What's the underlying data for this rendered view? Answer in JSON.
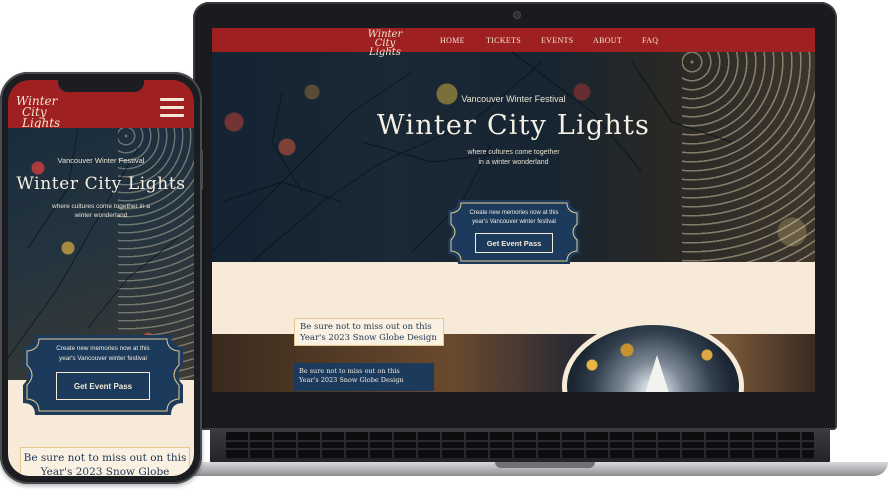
{
  "site": {
    "logo": {
      "line1": "Winter",
      "line2": "City Lights"
    },
    "nav": [
      "HOME",
      "TICKETS",
      "EVENTS",
      "ABOUT",
      "FAQ"
    ],
    "hero": {
      "eyebrow": "Vancouver Winter Festival",
      "title": "Winter City Lights",
      "tagline_line1": "where cultures come together",
      "tagline_line2": "in a winter wonderland",
      "mobile_tagline_line1": "where cultures come together in a",
      "mobile_tagline_line2": "winter wonderland"
    },
    "ticket": {
      "text_line1": "Create new memories now at this",
      "text_line2": "year's Vancouver winter festival",
      "button": "Get Event Pass"
    },
    "promo": {
      "line1": "Be sure not to miss out on this",
      "line2": "Year's 2023 Snow Globe Design"
    }
  },
  "colors": {
    "nav_red": "#9e2021",
    "navy": "#1b3a5c",
    "cream": "#f7ead8",
    "gold_border": "#e6c98c"
  },
  "icons": {
    "menu": "hamburger-icon",
    "camera": "camera-icon"
  }
}
